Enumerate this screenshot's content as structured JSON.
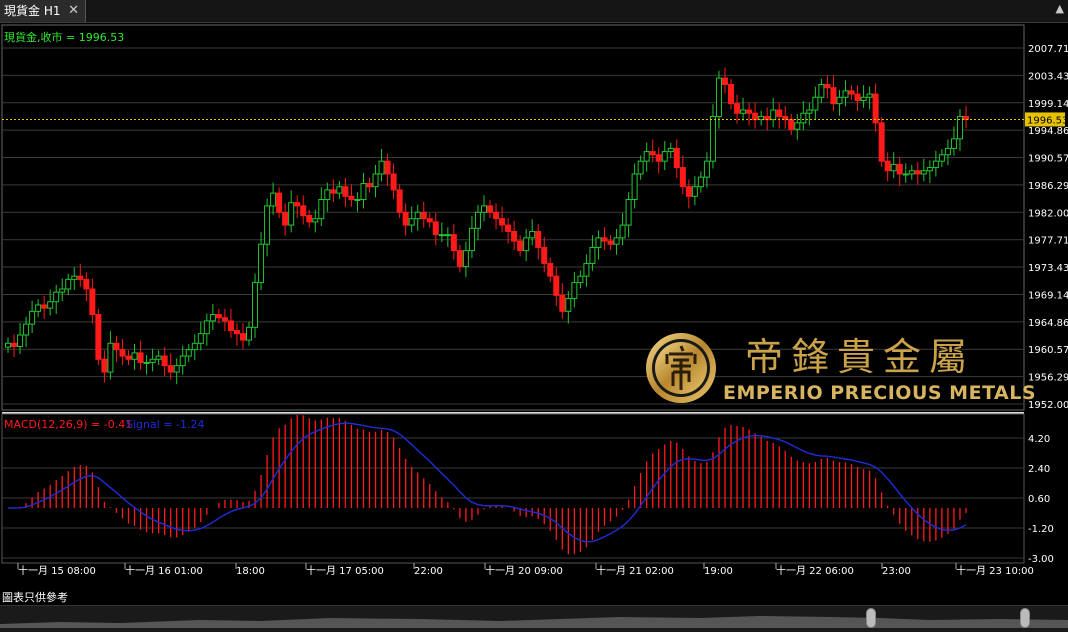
{
  "tab": {
    "title": "現貨金 H1",
    "close": "✕",
    "window_button": "▲"
  },
  "price_panel": {
    "legend": "現貨金,收市 = 1996.53",
    "current_price_label": "1996.53",
    "current_price": 1996.53,
    "y_ticks": [
      "2007.71",
      "2003.43",
      "1999.14",
      "1994.86",
      "1990.57",
      "1986.29",
      "1982.00",
      "1977.71",
      "1973.43",
      "1969.14",
      "1964.86",
      "1960.57",
      "1956.29",
      "1952.00"
    ],
    "y_range": [
      1952.0,
      2007.71
    ]
  },
  "macd_panel": {
    "legend_main": "MACD(12,26,9) = -0.41",
    "legend_signal": "Signal = -1.24",
    "y_ticks": [
      "4.20",
      "2.40",
      "0.60",
      "-1.20",
      "-3.00"
    ],
    "y_range": [
      -3.0,
      4.2
    ]
  },
  "x_ticks": [
    "十一月 15 08:00",
    "十一月 16 01:00",
    "18:00",
    "十一月 17 05:00",
    "22:00",
    "十一月 20 09:00",
    "十一月 21 02:00",
    "19:00",
    "十一月 22 06:00",
    "23:00",
    "十一月 23 10:00"
  ],
  "footnote": "圖表只供參考",
  "logo": {
    "chinese": "帝鋒貴金屬",
    "english": "EMPERIO PRECIOUS METALS"
  },
  "colors": {
    "up": "#22c532",
    "down": "#ff1a1a",
    "signal": "#1f2dd6",
    "grid": "#3a3a3a",
    "legend_green": "#2fe82f",
    "price_line": "#e6c200",
    "logo_gold": "#c9a24a"
  },
  "chart_data": {
    "type": "candlestick",
    "closes": [
      1961.5,
      1961.0,
      1962.8,
      1964.5,
      1966.5,
      1967.5,
      1967.0,
      1968.0,
      1969.5,
      1970.0,
      1971.5,
      1972.0,
      1971.5,
      1970.0,
      1966.0,
      1959.0,
      1957.0,
      1961.5,
      1960.5,
      1959.5,
      1959.0,
      1960.0,
      1958.5,
      1958.5,
      1959.0,
      1959.5,
      1958.0,
      1957.0,
      1958.0,
      1959.5,
      1960.5,
      1961.5,
      1963.0,
      1965.0,
      1966.0,
      1965.5,
      1965.0,
      1963.5,
      1963.0,
      1962.0,
      1964.0,
      1971.0,
      1977.0,
      1983.0,
      1985.0,
      1982.0,
      1980.0,
      1983.5,
      1983.0,
      1981.5,
      1980.5,
      1981.0,
      1984.0,
      1985.5,
      1985.0,
      1986.0,
      1984.5,
      1984.0,
      1984.0,
      1986.5,
      1986.0,
      1988.0,
      1990.0,
      1988.0,
      1985.5,
      1982.0,
      1980.0,
      1981.0,
      1982.0,
      1981.0,
      1980.5,
      1978.5,
      1978.5,
      1978.5,
      1976.0,
      1973.5,
      1976.0,
      1979.5,
      1982.0,
      1983.0,
      1982.0,
      1981.0,
      1980.0,
      1979.0,
      1977.5,
      1976.0,
      1978.0,
      1979.0,
      1976.5,
      1974.0,
      1972.0,
      1969.0,
      1966.5,
      1968.5,
      1971.0,
      1972.0,
      1974.0,
      1976.5,
      1978.0,
      1977.5,
      1977.0,
      1978.0,
      1980.0,
      1984.0,
      1988.0,
      1990.0,
      1991.5,
      1991.0,
      1990.0,
      1991.5,
      1992.0,
      1989.0,
      1986.0,
      1984.5,
      1986.0,
      1987.5,
      1990.0,
      1997.0,
      2003.0,
      2002.0,
      1999.0,
      1997.5,
      1998.0,
      1997.5,
      1996.5,
      1997.0,
      1996.5,
      1998.0,
      1997.0,
      1996.5,
      1995.0,
      1996.0,
      1997.5,
      1998.0,
      2000.0,
      2002.0,
      2001.5,
      1999.0,
      2000.0,
      2001.0,
      2000.5,
      1999.5,
      2000.0,
      2000.5,
      1996.0,
      1990.0,
      1988.5,
      1989.5,
      1988.0,
      1988.0,
      1988.5,
      1988.0,
      1988.5,
      1989.0,
      1990.0,
      1991.0,
      1992.0,
      1993.5,
      1997.0,
      1996.53
    ]
  }
}
